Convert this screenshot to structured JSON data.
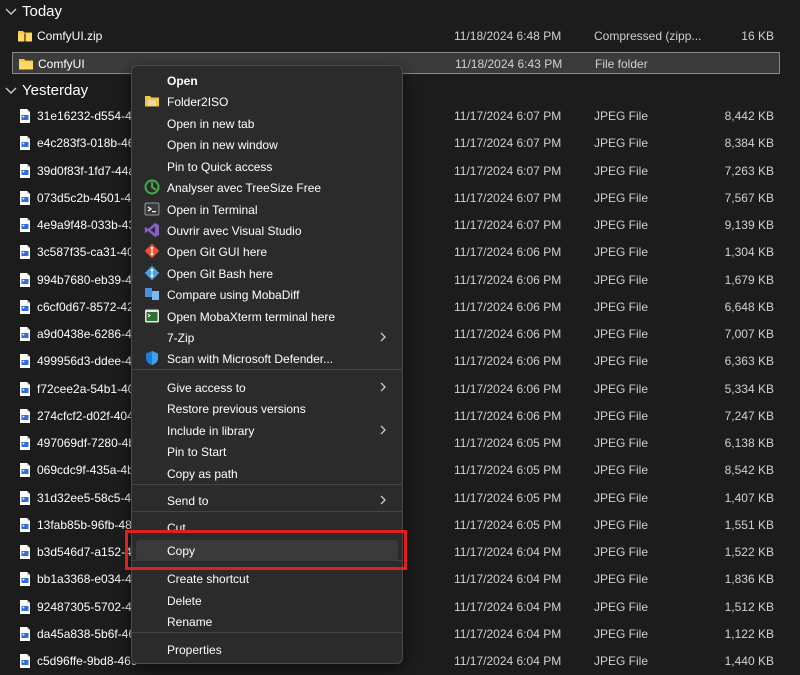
{
  "groups": {
    "today": "Today",
    "yesterday": "Yesterday"
  },
  "today_rows": [
    {
      "name": "ComfyUI.zip",
      "date": "11/18/2024 6:48 PM",
      "type": "Compressed (zipp...",
      "size": "16 KB",
      "icon": "zip-folder-icon"
    },
    {
      "name": "ComfyUI",
      "date": "11/18/2024 6:43 PM",
      "type": "File folder",
      "size": "",
      "icon": "folder-icon"
    }
  ],
  "yesterday_rows": [
    {
      "name": "31e16232-d554-4c",
      "date": "11/17/2024 6:07 PM",
      "type": "JPEG File",
      "size": "8,442 KB"
    },
    {
      "name": "e4c283f3-018b-46a",
      "date": "11/17/2024 6:07 PM",
      "type": "JPEG File",
      "size": "8,384 KB"
    },
    {
      "name": "39d0f83f-1fd7-44a",
      "date": "11/17/2024 6:07 PM",
      "type": "JPEG File",
      "size": "7,263 KB"
    },
    {
      "name": "073d5c2b-4501-49",
      "date": "11/17/2024 6:07 PM",
      "type": "JPEG File",
      "size": "7,567 KB"
    },
    {
      "name": "4e9a9f48-033b-435",
      "date": "11/17/2024 6:07 PM",
      "type": "JPEG File",
      "size": "9,139 KB"
    },
    {
      "name": "3c587f35-ca31-405",
      "date": "11/17/2024 6:06 PM",
      "type": "JPEG File",
      "size": "1,304 KB"
    },
    {
      "name": "994b7680-eb39-4b",
      "date": "11/17/2024 6:06 PM",
      "type": "JPEG File",
      "size": "1,679 KB"
    },
    {
      "name": "c6cf0d67-8572-42c",
      "date": "11/17/2024 6:06 PM",
      "type": "JPEG File",
      "size": "6,648 KB"
    },
    {
      "name": "a9d0438e-6286-44",
      "date": "11/17/2024 6:06 PM",
      "type": "JPEG File",
      "size": "7,007 KB"
    },
    {
      "name": "499956d3-ddee-42",
      "date": "11/17/2024 6:06 PM",
      "type": "JPEG File",
      "size": "6,363 KB"
    },
    {
      "name": "f72cee2a-54b1-409",
      "date": "11/17/2024 6:06 PM",
      "type": "JPEG File",
      "size": "5,334 KB"
    },
    {
      "name": "274cfcf2-d02f-404",
      "date": "11/17/2024 6:06 PM",
      "type": "JPEG File",
      "size": "7,247 KB"
    },
    {
      "name": "497069df-7280-4b",
      "date": "11/17/2024 6:05 PM",
      "type": "JPEG File",
      "size": "6,138 KB"
    },
    {
      "name": "069cdc9f-435a-4b",
      "date": "11/17/2024 6:05 PM",
      "type": "JPEG File",
      "size": "8,542 KB"
    },
    {
      "name": "31d32ee5-58c5-4e",
      "date": "11/17/2024 6:05 PM",
      "type": "JPEG File",
      "size": "1,407 KB"
    },
    {
      "name": "13fab85b-96fb-48",
      "date": "11/17/2024 6:05 PM",
      "type": "JPEG File",
      "size": "1,551 KB"
    },
    {
      "name": "b3d546d7-a152-41",
      "date": "11/17/2024 6:04 PM",
      "type": "JPEG File",
      "size": "1,522 KB"
    },
    {
      "name": "bb1a3368-e034-42",
      "date": "11/17/2024 6:04 PM",
      "type": "JPEG File",
      "size": "1,836 KB"
    },
    {
      "name": "92487305-5702-4d",
      "date": "11/17/2024 6:04 PM",
      "type": "JPEG File",
      "size": "1,512 KB"
    },
    {
      "name": "da45a838-5b6f-462",
      "date": "11/17/2024 6:04 PM",
      "type": "JPEG File",
      "size": "1,122 KB"
    },
    {
      "name": "c5d96ffe-9bd8-469",
      "date": "11/17/2024 6:04 PM",
      "type": "JPEG File",
      "size": "1,440 KB"
    }
  ],
  "context_menu": {
    "items": [
      {
        "label": "Open",
        "bold": true,
        "icon": ""
      },
      {
        "label": "Folder2ISO",
        "icon": "folder2iso-icon"
      },
      {
        "label": "Open in new tab",
        "icon": ""
      },
      {
        "label": "Open in new window",
        "icon": ""
      },
      {
        "label": "Pin to Quick access",
        "icon": ""
      },
      {
        "label": "Analyser avec TreeSize Free",
        "icon": "treesize-icon"
      },
      {
        "label": "Open in Terminal",
        "icon": "terminal-icon"
      },
      {
        "label": "Ouvrir avec Visual Studio",
        "icon": "visual-studio-icon"
      },
      {
        "label": "Open Git GUI here",
        "icon": "git-gui-icon"
      },
      {
        "label": "Open Git Bash here",
        "icon": "git-bash-icon"
      },
      {
        "label": "Compare using MobaDiff",
        "icon": "mobadiff-icon"
      },
      {
        "label": "Open MobaXterm terminal here",
        "icon": "mobaxterm-icon"
      },
      {
        "label": "7-Zip",
        "icon": "",
        "submenu": true
      },
      {
        "label": "Scan with Microsoft Defender...",
        "icon": "defender-shield-icon"
      },
      {
        "label": "Give access to",
        "icon": "",
        "submenu": true
      },
      {
        "label": "Restore previous versions",
        "icon": ""
      },
      {
        "label": "Include in library",
        "icon": "",
        "submenu": true
      },
      {
        "label": "Pin to Start",
        "icon": ""
      },
      {
        "label": "Copy as path",
        "icon": ""
      },
      {
        "label": "Send to",
        "icon": "",
        "submenu": true
      },
      {
        "label": "Cut",
        "icon": ""
      },
      {
        "label": "Copy",
        "icon": "",
        "hover": true
      },
      {
        "label": "Create shortcut",
        "icon": ""
      },
      {
        "label": "Delete",
        "icon": ""
      },
      {
        "label": "Rename",
        "icon": ""
      },
      {
        "label": "Properties",
        "icon": ""
      }
    ]
  },
  "colors": {
    "background": "#1c1c1c",
    "menu": "#2b2b2b",
    "highlight": "#e02020",
    "folder": "#f4c542"
  }
}
